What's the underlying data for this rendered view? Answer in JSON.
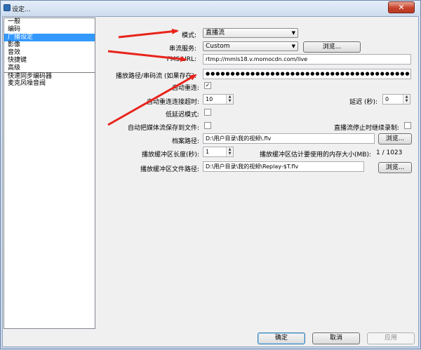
{
  "window": {
    "title": "设定..."
  },
  "sidebar": {
    "items": [
      {
        "label": "一般"
      },
      {
        "label": "编码"
      },
      {
        "label": "广播设定"
      },
      {
        "label": "影像"
      },
      {
        "label": "音效"
      },
      {
        "label": "快捷键"
      },
      {
        "label": "高级"
      },
      {
        "label": "快速同步编码器"
      },
      {
        "label": "麦克风噪音阀"
      }
    ],
    "selected_index": 2
  },
  "form": {
    "mode_label": "模式:",
    "mode_value": "直播流",
    "service_label": "串流服务:",
    "service_value": "Custom",
    "browse_label": "浏览...",
    "fms_label": "FMS URL:",
    "fms_value": "rtmp://mmls18.v.momocdn.com/live",
    "key_label": "播放路径/串码流 (如果存在):",
    "key_value": "●●●●●●●●●●●●●●●●●●●●●●●●●●●●●●●●●●●●●●●●●●●●●●●●●●●●●●●●●●●●●●●●●●●●●●●",
    "autoreconnect_label": "自动重连:",
    "autoreconnect_checked": true,
    "timeout_label": "自动重连连接超时:",
    "timeout_value": "10",
    "delay_label": "延迟 (秒):",
    "delay_value": "0",
    "lowlatency_label": "低延迟模式:",
    "save_label": "自动把媒体流保存到文件:",
    "keeprec_label": "直播流停止时继续录制:",
    "filepath_label": "档案路径:",
    "filepath_value": "D:\\用户目录\\我的视频\\.flv",
    "buffer_len_label": "播放缓冲区长度(秒):",
    "buffer_len_value": "1",
    "buffer_mem_label": "播放缓冲区估计要使用的内存大小(MB):",
    "buffer_mem_value": "1 / 1023",
    "buffer_path_label": "播放缓冲区文件路径:",
    "buffer_path_value": "D:\\用户目录\\我的视频\\Replay-$T.flv"
  },
  "footer": {
    "ok_label": "确定",
    "cancel_label": "取消",
    "apply_label": "应用"
  },
  "colors": {
    "arrow": "#e8231b",
    "selection": "#3399ff",
    "close": "#c7432b"
  },
  "icons": {
    "close": "close-icon",
    "dropdown": "chevron-down-icon",
    "check": "checkmark-icon"
  }
}
